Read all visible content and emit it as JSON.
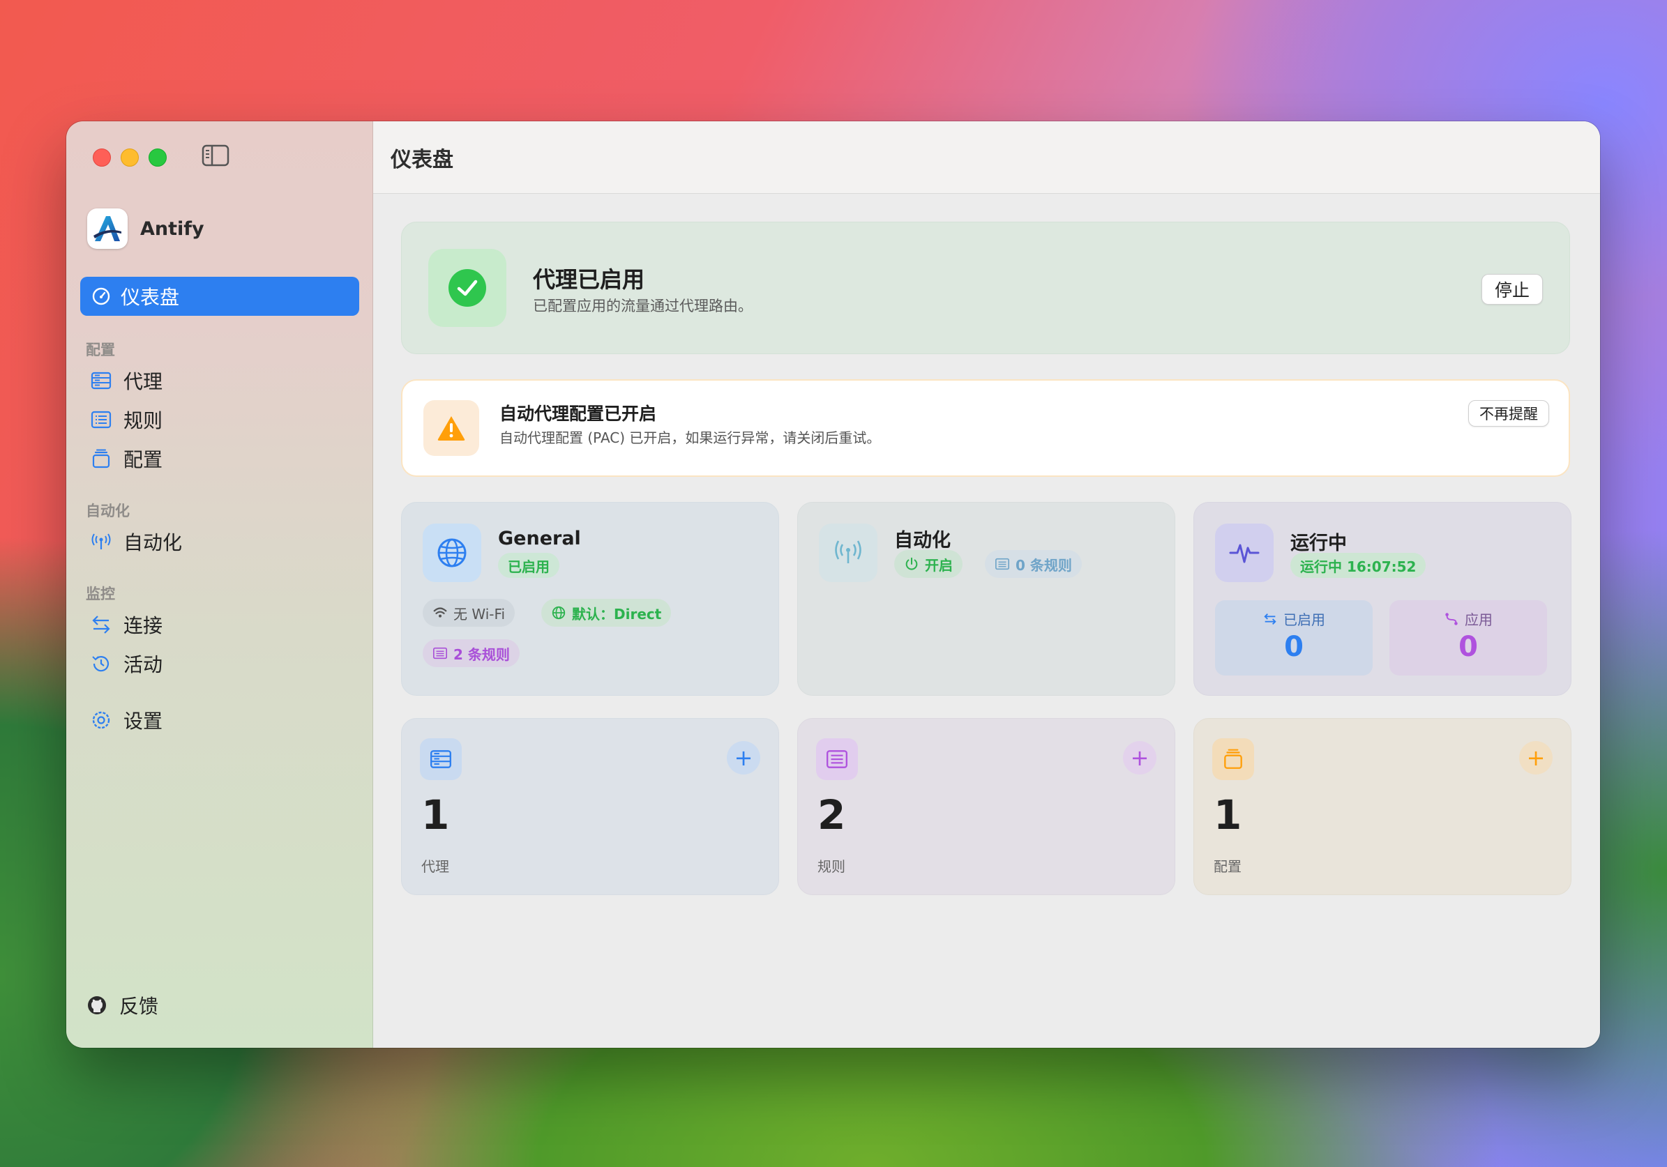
{
  "sidebar": {
    "app_name": "Antify",
    "active_item": "仪表盘",
    "sections": {
      "config": "配置",
      "automation": "自动化",
      "monitor": "监控"
    },
    "items": {
      "proxy": "代理",
      "rules": "规则",
      "profiles": "配置",
      "automation": "自动化",
      "connections": "连接",
      "activity": "活动",
      "settings": "设置",
      "feedback": "反馈"
    }
  },
  "header": {
    "title": "仪表盘"
  },
  "status": {
    "title": "代理已启用",
    "subtitle": "已配置应用的流量通过代理路由。",
    "stop_label": "停止"
  },
  "warning": {
    "title": "自动代理配置已开启",
    "subtitle": "自动代理配置 (PAC) 已开启，如果运行异常，请关闭后重试。",
    "dismiss_label": "不再提醒"
  },
  "general_card": {
    "title": "General",
    "badge": "已启用",
    "wifi": "无 Wi-Fi",
    "default": "默认：Direct",
    "rules": "2 条规则"
  },
  "automation_card": {
    "title": "自动化",
    "state": "开启",
    "rules": "0 条规则"
  },
  "running_card": {
    "title": "运行中",
    "badge": "运行中 16:07:52",
    "enabled_label": "已启用",
    "enabled_value": "0",
    "apps_label": "应用",
    "apps_value": "0"
  },
  "counts": {
    "proxy": {
      "value": "1",
      "label": "代理"
    },
    "rules": {
      "value": "2",
      "label": "规则"
    },
    "profiles": {
      "value": "1",
      "label": "配置"
    }
  },
  "colors": {
    "accent": "#2d7ff0",
    "success": "#34c759",
    "warning": "#ff9f0a",
    "purple": "#af52de"
  }
}
